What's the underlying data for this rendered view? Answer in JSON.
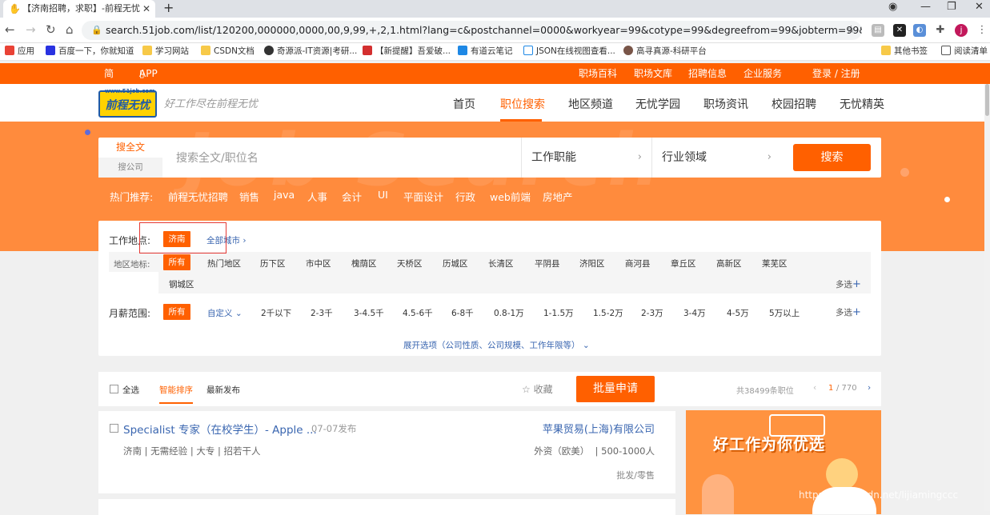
{
  "browser": {
    "tab_title": "【济南招聘，求职】-前程无忧",
    "url": "search.51job.com/list/120200,000000,0000,00,9,99,+,2,1.html?lang=c&postchannel=0000&workyear=99&cotype=99&degreefrom=99&jobterm=99&companysize=...",
    "profile_initial": "j",
    "bookmarks": [
      "应用",
      "百度一下，你就知道",
      "学习网站",
      "CSDN文档",
      "奇源派-IT资源|考研...",
      "【新提醒】吾爱破...",
      "有道云笔记",
      "JSON在线视图查看...",
      "高寻真源-科研平台",
      "其他书签",
      "阅读清单"
    ]
  },
  "topbar": {
    "lang": "简",
    "app": "APP下载",
    "links": [
      "职场百科",
      "职场文库",
      "招聘信息",
      "企业服务"
    ],
    "login": "登录 / 注册"
  },
  "header": {
    "logo_site": "www.51job.com",
    "logo_text": "前程无忧",
    "slogan": "好工作尽在前程无忧",
    "nav": [
      "首页",
      "职位搜索",
      "地区频道",
      "无忧学园",
      "职场资讯",
      "校园招聘",
      "无忧精英"
    ],
    "active_nav": "职位搜索"
  },
  "search": {
    "tab_fulltext": "搜全文",
    "tab_company": "搜公司",
    "placeholder": "搜索全文/职位名",
    "function_label": "工作职能",
    "industry_label": "行业领域",
    "button": "搜索",
    "hot_label": "热门推荐:",
    "hot": [
      "前程无忧招聘",
      "销售",
      "java",
      "人事",
      "会计",
      "UI",
      "平面设计",
      "行政",
      "web前端",
      "房地产"
    ]
  },
  "filter": {
    "location_label": "工作地点:",
    "location_selected": "济南",
    "all_cities": "全部城市",
    "district_label": "地区地标:",
    "districts": [
      "所有",
      "热门地区",
      "历下区",
      "市中区",
      "槐荫区",
      "天桥区",
      "历城区",
      "长清区",
      "平阴县",
      "济阳区",
      "商河县",
      "章丘区",
      "高新区",
      "莱芜区",
      "钢城区"
    ],
    "salary_label": "月薪范围:",
    "salaries": [
      "所有",
      "自定义",
      "2千以下",
      "2-3千",
      "3-4.5千",
      "4.5-6千",
      "6-8千",
      "0.8-1万",
      "1-1.5万",
      "1.5-2万",
      "2-3万",
      "3-4万",
      "4-5万",
      "5万以上"
    ],
    "multi": "多选",
    "expand": "展开选项（公司性质、公司规模、工作年限等）"
  },
  "list_bar": {
    "select_all": "全选",
    "sort_smart": "智能排序",
    "sort_latest": "最新发布",
    "favorite": "收藏",
    "batch_apply": "批量申请",
    "total": "共38499条职位",
    "page_current": "1",
    "page_total": "/ 770"
  },
  "job": {
    "title": "Specialist 专家（在校学生）- Apple ...",
    "date": "07-07发布",
    "company": "苹果贸易(上海)有限公司",
    "meta": "济南 | 无需经验 | 大专 | 招若干人",
    "company_type": "外资（欧美）  | 500-1000人",
    "industry": "批发/零售"
  },
  "ad": {
    "text": "好工作为你优选"
  },
  "watermark": "https://blog.csdn.net/lijiamingccc",
  "colors": {
    "brand": "#ff6000",
    "banner": "#ff8b3d",
    "link": "#3a66b0"
  }
}
